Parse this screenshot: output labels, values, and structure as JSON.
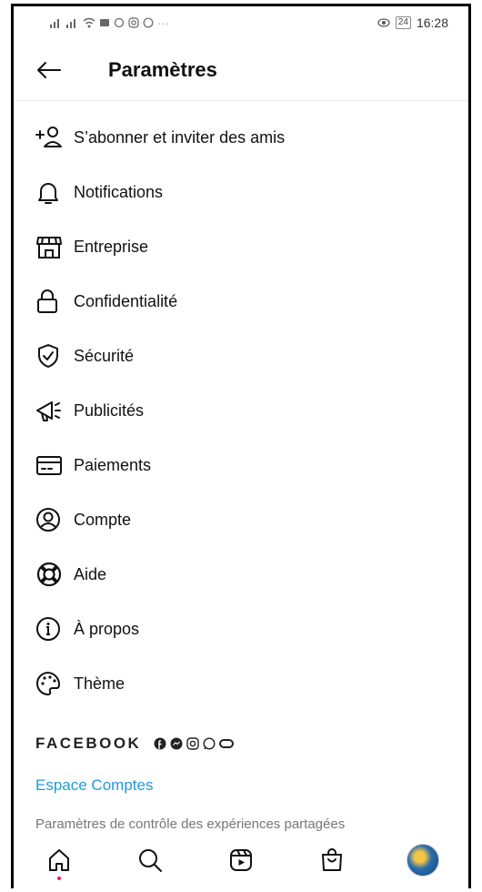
{
  "status_bar": {
    "time": "16:28",
    "battery": "24",
    "more": "···"
  },
  "header": {
    "title": "Paramètres"
  },
  "menu": [
    {
      "label": "S’abonner et inviter des amis",
      "icon": "add-person-icon"
    },
    {
      "label": "Notifications",
      "icon": "bell-icon"
    },
    {
      "label": "Entreprise",
      "icon": "store-icon"
    },
    {
      "label": "Confidentialité",
      "icon": "lock-icon"
    },
    {
      "label": "Sécurité",
      "icon": "shield-check-icon"
    },
    {
      "label": "Publicités",
      "icon": "megaphone-icon"
    },
    {
      "label": "Paiements",
      "icon": "card-icon"
    },
    {
      "label": "Compte",
      "icon": "account-circle-icon"
    },
    {
      "label": "Aide",
      "icon": "lifebuoy-icon"
    },
    {
      "label": "À propos",
      "icon": "info-icon"
    },
    {
      "label": "Thème",
      "icon": "palette-icon"
    }
  ],
  "facebook": {
    "title": "FACEBOOK",
    "link": "Espace Comptes",
    "description": "Paramètres de contrôle des expériences partagées"
  },
  "bottom_nav": [
    "home-icon",
    "search-icon",
    "reels-icon",
    "shop-icon",
    "profile-avatar"
  ],
  "colors": {
    "link": "#1f9bd6",
    "notification_dot": "#e0245e"
  }
}
